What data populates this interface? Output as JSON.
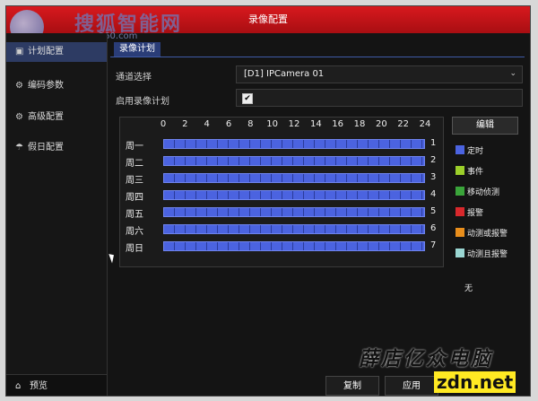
{
  "window": {
    "title": "录像配置"
  },
  "logo": {
    "text": "搜狐智能网",
    "sub": "www.360.com"
  },
  "sidebar": {
    "items": [
      {
        "label": "计划配置",
        "icon": "schedule-icon"
      },
      {
        "label": "编码参数",
        "icon": "gear-icon"
      },
      {
        "label": "高级配置",
        "icon": "gear-icon"
      },
      {
        "label": "假日配置",
        "icon": "umbrella-icon"
      }
    ],
    "preview": "预览"
  },
  "tab": {
    "label": "录像计划"
  },
  "channel": {
    "label": "通道选择",
    "value": "[D1] IPCamera 01"
  },
  "enable": {
    "label": "启用录像计划",
    "checked": "✔"
  },
  "schedule": {
    "hours": [
      "0",
      "2",
      "4",
      "6",
      "8",
      "10",
      "12",
      "14",
      "16",
      "18",
      "20",
      "22",
      "24"
    ],
    "days": [
      {
        "label": "周一",
        "num": "1"
      },
      {
        "label": "周二",
        "num": "2"
      },
      {
        "label": "周三",
        "num": "3"
      },
      {
        "label": "周四",
        "num": "4"
      },
      {
        "label": "周五",
        "num": "5"
      },
      {
        "label": "周六",
        "num": "6"
      },
      {
        "label": "周日",
        "num": "7"
      }
    ],
    "bar_color": "#4b63e0"
  },
  "legend": {
    "edit": "编辑",
    "items": [
      {
        "label": "定时",
        "color": "#4b63e0"
      },
      {
        "label": "事件",
        "color": "#9ccf2a"
      },
      {
        "label": "移动侦测",
        "color": "#3aa43a"
      },
      {
        "label": "报警",
        "color": "#d8282c"
      },
      {
        "label": "动测或报警",
        "color": "#e88e1c"
      },
      {
        "label": "动测且报警",
        "color": "#9ad6d2"
      }
    ],
    "none": "无"
  },
  "buttons": {
    "copy": "复制",
    "apply": "应用"
  },
  "watermark": {
    "text": "薛店亿众电脑",
    "url": "zdn.net"
  }
}
